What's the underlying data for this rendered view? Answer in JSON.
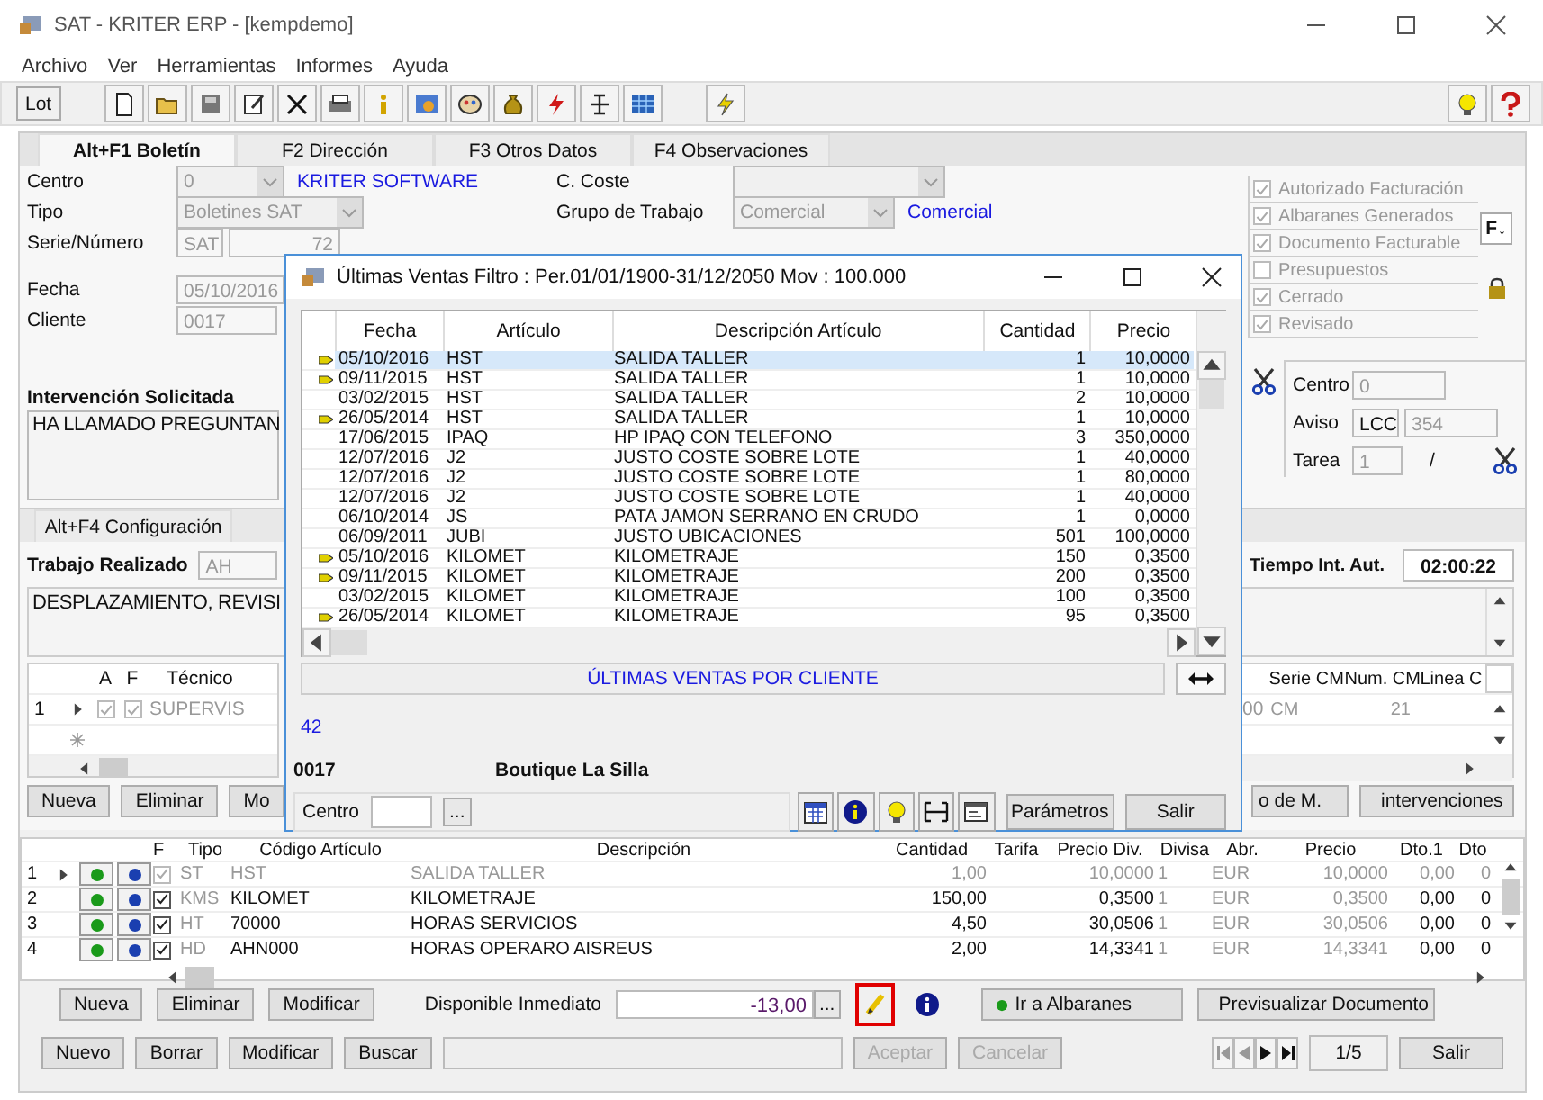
{
  "window": {
    "title": "SAT - KRITER ERP - [kempdemo]"
  },
  "menu": [
    "Archivo",
    "Ver",
    "Herramientas",
    "Informes",
    "Ayuda"
  ],
  "toolbar": {
    "lot_button": "Lot"
  },
  "tabs": [
    {
      "label": "Alt+F1 Boletín",
      "selected": true
    },
    {
      "label": "F2 Dirección",
      "selected": false
    },
    {
      "label": "F3 Otros Datos",
      "selected": false
    },
    {
      "label": "F4 Observaciones",
      "selected": false
    }
  ],
  "header": {
    "centro": {
      "label": "Centro",
      "value": "0",
      "name": "KRITER SOFTWARE"
    },
    "tipo": {
      "label": "Tipo",
      "value": "Boletines SAT"
    },
    "serie": {
      "label": "Serie/Número",
      "series": "SAT",
      "number": "72"
    },
    "fecha": {
      "label": "Fecha",
      "value": "05/10/2016"
    },
    "cliente": {
      "label": "Cliente",
      "value": "0017"
    },
    "coste": {
      "label": "C. Coste"
    },
    "grupo": {
      "label": "Grupo de Trabajo",
      "value": "Comercial",
      "link": "Comercial"
    }
  },
  "flags": [
    {
      "label": "Autorizado Facturación",
      "checked": true
    },
    {
      "label": "Albaranes Generados",
      "checked": true
    },
    {
      "label": "Documento Facturable",
      "checked": true
    },
    {
      "label": "Presupuestos",
      "checked": false
    },
    {
      "label": "Cerrado",
      "checked": true
    },
    {
      "label": "Revisado",
      "checked": true
    }
  ],
  "sort_button": "F↓",
  "intervention": {
    "label": "Intervención Solicitada",
    "text": "HA LLAMADO PREGUNTAN"
  },
  "aviso_panel": {
    "centro_label": "Centro",
    "centro_value": "0",
    "aviso_label": "Aviso",
    "aviso_series": "LCC",
    "aviso_number": "354",
    "tarea_label": "Tarea",
    "tarea_value": "1",
    "separator": "/"
  },
  "lower_tabs": [
    {
      "label": "Alt+F4 Configuración",
      "selected": false
    }
  ],
  "work": {
    "label": "Trabajo Realizado",
    "code": "AH",
    "text": "DESPLAZAMIENTO, REVISI",
    "time_label": "Tiempo Int. Aut.",
    "time": "02:00:22"
  },
  "technicians": {
    "columns": [
      "A",
      "F",
      "Técnico"
    ],
    "right_columns": [
      "Serie CM",
      "Num. CM",
      "Linea C"
    ],
    "rows": [
      {
        "number": "1",
        "a": true,
        "f": true,
        "name": "SUPERVIS",
        "cut_value": "00",
        "serie": "CM",
        "num": "21"
      }
    ]
  },
  "tech_buttons": [
    "Nueva",
    "Eliminar",
    "Mo"
  ],
  "tech_right_buttons": [
    "o de M.",
    "intervenciones"
  ],
  "lines": {
    "columns": [
      "F",
      "Tipo",
      "Código Artículo",
      "Descripción",
      "Cantidad",
      "Tarifa",
      "Precio Div.",
      "Divisa",
      "Abr.",
      "Precio",
      "Dto.1",
      "Dto"
    ],
    "rows": [
      {
        "number": "1",
        "current": true,
        "checked": true,
        "disabled": true,
        "tipo": "ST",
        "codigo": "HST",
        "descripcion": "SALIDA TALLER",
        "cantidad": "1,00",
        "precio_div": "10,0000",
        "divisa": "1",
        "abr": "EUR",
        "precio": "10,0000",
        "dto1": "0,00",
        "dto": "0"
      },
      {
        "number": "2",
        "current": false,
        "checked": true,
        "disabled": false,
        "tipo": "KMS",
        "codigo": "KILOMET",
        "descripcion": "KILOMETRAJE",
        "cantidad": "150,00",
        "precio_div": "0,3500",
        "divisa": "1",
        "abr": "EUR",
        "precio": "0,3500",
        "dto1": "0,00",
        "dto": "0"
      },
      {
        "number": "3",
        "current": false,
        "checked": true,
        "disabled": false,
        "tipo": "HT",
        "codigo": "70000",
        "descripcion": "HORAS SERVICIOS",
        "cantidad": "4,50",
        "precio_div": "30,0506",
        "divisa": "1",
        "abr": "EUR",
        "precio": "30,0506",
        "dto1": "0,00",
        "dto": "0"
      },
      {
        "number": "4",
        "current": false,
        "checked": true,
        "disabled": false,
        "tipo": "HD",
        "codigo": "AHN000",
        "descripcion": "HORAS OPERARO AISREUS",
        "cantidad": "2,00",
        "precio_div": "14,3341",
        "divisa": "1",
        "abr": "EUR",
        "precio": "14,3341",
        "dto1": "0,00",
        "dto": "0"
      }
    ]
  },
  "line_buttons": [
    "Nueva",
    "Eliminar",
    "Modificar"
  ],
  "available": {
    "label": "Disponible Inmediato",
    "value": "-13,00",
    "more": "..."
  },
  "doc_buttons": [
    "Ir a Albaranes",
    "Previsualizar Documento"
  ],
  "footer": {
    "buttons": [
      {
        "label": "Nuevo",
        "disabled": false
      },
      {
        "label": "Borrar",
        "disabled": false
      },
      {
        "label": "Modificar",
        "disabled": false
      },
      {
        "label": "Buscar",
        "disabled": false
      }
    ],
    "confirm_buttons": [
      {
        "label": "Aceptar",
        "disabled": true
      },
      {
        "label": "Cancelar",
        "disabled": true
      }
    ],
    "page": "1/5",
    "exit": "Salir"
  },
  "dialog": {
    "title": "Últimas Ventas Filtro : Per.01/01/1900-31/12/2050 Mov : 100.000",
    "columns": [
      "Fecha",
      "Artículo",
      "Descripción Artículo",
      "Cantidad",
      "Precio"
    ],
    "rows": [
      {
        "flagged": true,
        "selected": true,
        "fecha": "05/10/2016",
        "articulo": "HST",
        "descripcion": "SALIDA TALLER",
        "cantidad": "1",
        "precio": "10,0000"
      },
      {
        "flagged": true,
        "selected": false,
        "fecha": "09/11/2015",
        "articulo": "HST",
        "descripcion": "SALIDA TALLER",
        "cantidad": "1",
        "precio": "10,0000"
      },
      {
        "flagged": false,
        "selected": false,
        "fecha": "03/02/2015",
        "articulo": "HST",
        "descripcion": "SALIDA TALLER",
        "cantidad": "2",
        "precio": "10,0000"
      },
      {
        "flagged": true,
        "selected": false,
        "fecha": "26/05/2014",
        "articulo": "HST",
        "descripcion": "SALIDA TALLER",
        "cantidad": "1",
        "precio": "10,0000"
      },
      {
        "flagged": false,
        "selected": false,
        "fecha": "17/06/2015",
        "articulo": "IPAQ",
        "descripcion": "HP IPAQ CON TELEFONO",
        "cantidad": "3",
        "precio": "350,0000"
      },
      {
        "flagged": false,
        "selected": false,
        "fecha": "12/07/2016",
        "articulo": "J2",
        "descripcion": "JUSTO COSTE SOBRE LOTE",
        "cantidad": "1",
        "precio": "40,0000"
      },
      {
        "flagged": false,
        "selected": false,
        "fecha": "12/07/2016",
        "articulo": "J2",
        "descripcion": "JUSTO COSTE SOBRE LOTE",
        "cantidad": "1",
        "precio": "80,0000"
      },
      {
        "flagged": false,
        "selected": false,
        "fecha": "12/07/2016",
        "articulo": "J2",
        "descripcion": "JUSTO COSTE SOBRE LOTE",
        "cantidad": "1",
        "precio": "40,0000"
      },
      {
        "flagged": false,
        "selected": false,
        "fecha": "06/10/2014",
        "articulo": "JS",
        "descripcion": "PATA JAMON SERRANO EN CRUDO",
        "cantidad": "1",
        "precio": "0,0000"
      },
      {
        "flagged": false,
        "selected": false,
        "fecha": "06/09/2011",
        "articulo": "JUBI",
        "descripcion": "JUSTO UBICACIONES",
        "cantidad": "501",
        "precio": "100,0000"
      },
      {
        "flagged": true,
        "selected": false,
        "fecha": "05/10/2016",
        "articulo": "KILOMET",
        "descripcion": "KILOMETRAJE",
        "cantidad": "150",
        "precio": "0,3500"
      },
      {
        "flagged": true,
        "selected": false,
        "fecha": "09/11/2015",
        "articulo": "KILOMET",
        "descripcion": "KILOMETRAJE",
        "cantidad": "200",
        "precio": "0,3500"
      },
      {
        "flagged": false,
        "selected": false,
        "fecha": "03/02/2015",
        "articulo": "KILOMET",
        "descripcion": "KILOMETRAJE",
        "cantidad": "100",
        "precio": "0,3500"
      },
      {
        "flagged": true,
        "selected": false,
        "fecha": "26/05/2014",
        "articulo": "KILOMET",
        "descripcion": "KILOMETRAJE",
        "cantidad": "95",
        "precio": "0,3500"
      }
    ],
    "caption": "ÚLTIMAS VENTAS POR CLIENTE",
    "count": "42",
    "customer_code": "0017",
    "customer_name": "Boutique La Silla",
    "centro_label": "Centro",
    "more": "...",
    "buttons": [
      "Parámetros",
      "Salir"
    ]
  }
}
